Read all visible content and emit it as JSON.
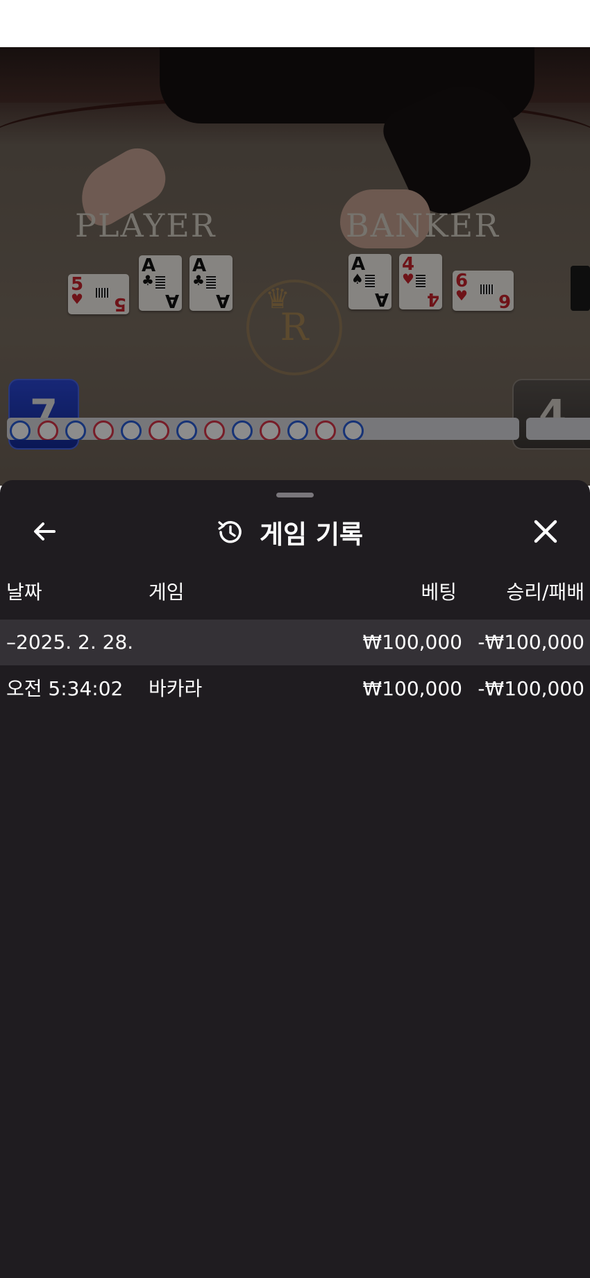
{
  "video": {
    "player_label": "PLAYER",
    "banker_label": "BANKER",
    "player_score": "7",
    "banker_score": "4",
    "crest_letter": "R",
    "player_cards": [
      {
        "rank": "5",
        "suit": "♥",
        "color": "red"
      },
      {
        "rank": "A",
        "suit": "♣",
        "color": "black"
      },
      {
        "rank": "A",
        "suit": "♣",
        "color": "black"
      }
    ],
    "banker_cards": [
      {
        "rank": "A",
        "suit": "♠",
        "color": "black"
      },
      {
        "rank": "4",
        "suit": "♥",
        "color": "red"
      },
      {
        "rank": "6",
        "suit": "♥",
        "color": "red"
      }
    ]
  },
  "sheet": {
    "title": "게임 기록",
    "icons": {
      "back": "arrow-left-icon",
      "history": "history-icon",
      "close": "close-icon"
    },
    "columns": {
      "date": "날짜",
      "game": "게임",
      "bet": "베팅",
      "winloss": "승리/패배"
    },
    "rows": [
      {
        "date": "–2025. 2. 28.",
        "game": "",
        "bet": "₩100,000",
        "winloss": "-₩100,000"
      },
      {
        "date": "오전 5:34:02",
        "game": "바카라",
        "bet": "₩100,000",
        "winloss": "-₩100,000"
      }
    ]
  },
  "colors": {
    "sheet_bg": "#1f1c20",
    "row_highlight": "#343136",
    "player_blue": "#1e3cc0",
    "banker_grey": "#4a4542"
  }
}
